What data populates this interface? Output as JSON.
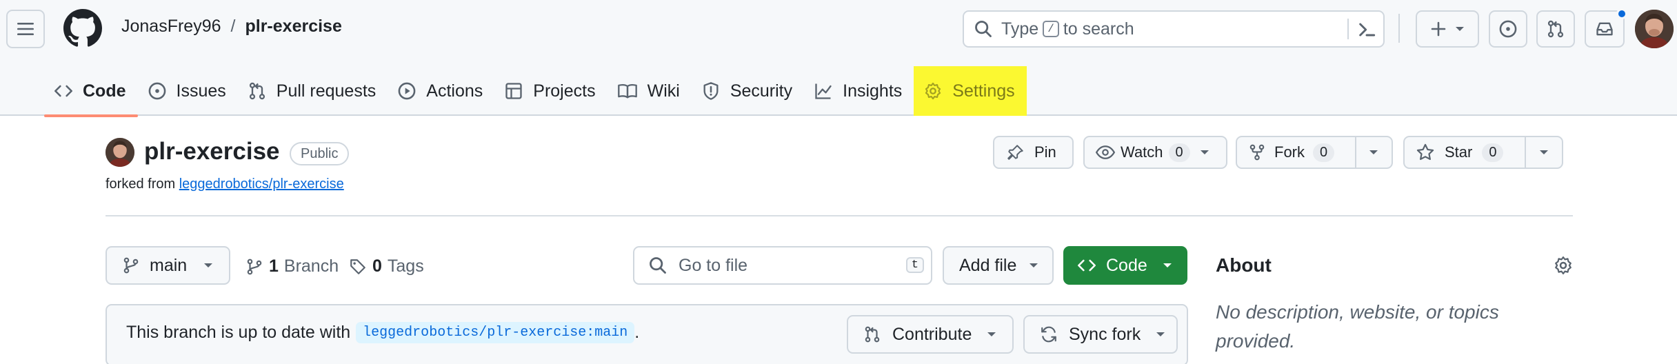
{
  "breadcrumb": {
    "owner": "JonasFrey96",
    "separator": "/",
    "repo": "plr-exercise"
  },
  "search": {
    "prefix": "Type",
    "key": "/",
    "suffix": "to search"
  },
  "nav": {
    "tabs": [
      {
        "label": "Code",
        "icon": "code-icon"
      },
      {
        "label": "Issues",
        "icon": "issue-icon"
      },
      {
        "label": "Pull requests",
        "icon": "pull-request-icon"
      },
      {
        "label": "Actions",
        "icon": "play-icon"
      },
      {
        "label": "Projects",
        "icon": "table-icon"
      },
      {
        "label": "Wiki",
        "icon": "book-icon"
      },
      {
        "label": "Security",
        "icon": "shield-icon"
      },
      {
        "label": "Insights",
        "icon": "graph-icon"
      },
      {
        "label": "Settings",
        "icon": "gear-icon"
      }
    ],
    "selected": "Code",
    "highlighted": "Settings"
  },
  "repo": {
    "name": "plr-exercise",
    "visibility": "Public",
    "forked_prefix": "forked from",
    "forked_from": "leggedrobotics/plr-exercise"
  },
  "actions": {
    "pin": "Pin",
    "watch": "Watch",
    "watch_count": "0",
    "fork": "Fork",
    "fork_count": "0",
    "star": "Star",
    "star_count": "0"
  },
  "files": {
    "branch": "main",
    "branch_count": "1",
    "branch_label": "Branch",
    "tag_count": "0",
    "tag_label": "Tags",
    "goto_placeholder": "Go to file",
    "goto_key": "t",
    "add_file": "Add file",
    "code": "Code"
  },
  "sync": {
    "status_text": "This branch is up to date with",
    "upstream_ref": "leggedrobotics/plr-exercise:main",
    "period": ".",
    "contribute": "Contribute",
    "sync_fork": "Sync fork"
  },
  "about": {
    "title": "About",
    "description": "No description, website, or topics provided."
  },
  "colors": {
    "accent_blue": "#0969da",
    "code_green": "#1f883d",
    "tab_underline": "#fd8c73",
    "settings_highlight": "#fbf831"
  }
}
